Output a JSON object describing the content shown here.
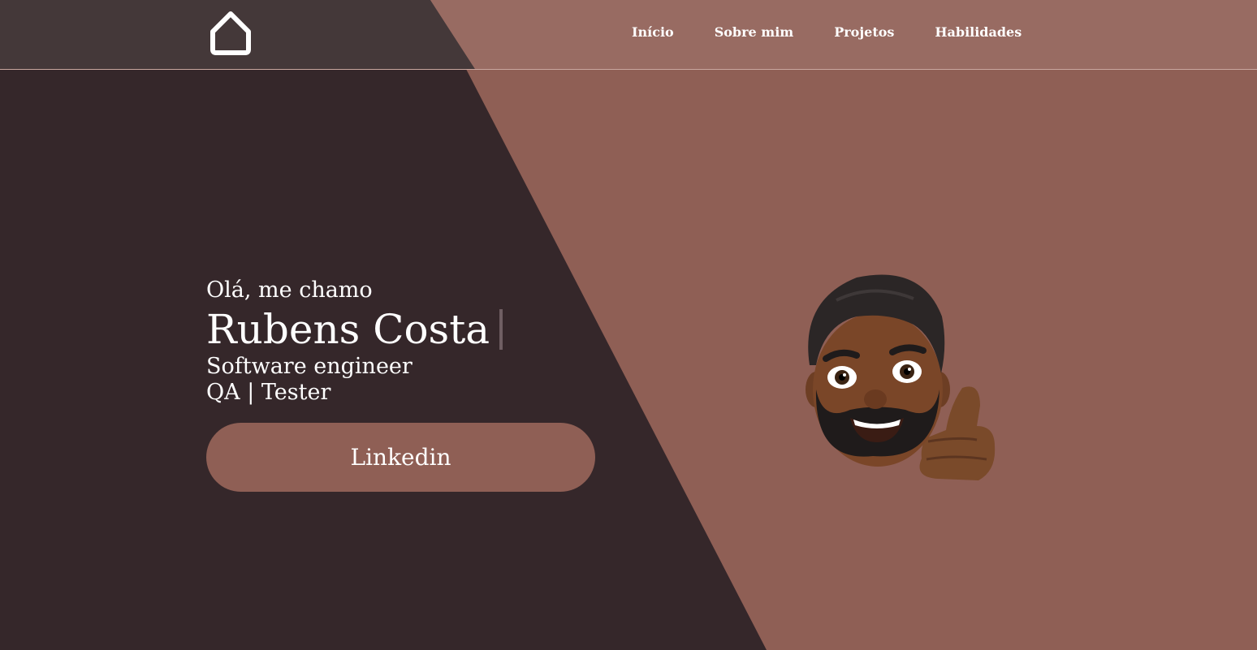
{
  "nav": {
    "items": [
      {
        "label": "Início"
      },
      {
        "label": "Sobre mim"
      },
      {
        "label": "Projetos"
      },
      {
        "label": "Habilidades"
      }
    ]
  },
  "hero": {
    "greeting": "Olá, me chamo",
    "name": "Rubens Costa",
    "role_line1": "Software engineer",
    "role_line2": "QA | Tester",
    "linkedin_label": "Linkedin"
  },
  "icons": {
    "home": "home-icon",
    "avatar": "memoji-thumbs-up"
  },
  "colors": {
    "dark_panel": "#35272a",
    "accent": "#8f5f55",
    "header_left": "#443839",
    "header_right": "#986b62",
    "text": "#ffffff"
  }
}
